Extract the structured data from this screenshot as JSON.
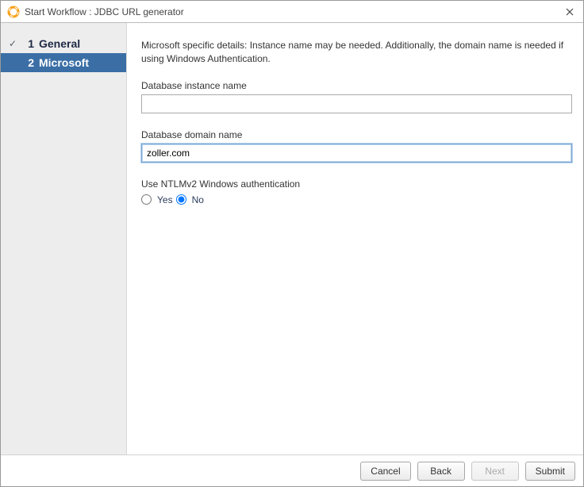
{
  "window": {
    "title": "Start Workflow : JDBC URL generator"
  },
  "sidebar": {
    "steps": [
      {
        "num": "1",
        "label": "General"
      },
      {
        "num": "2",
        "label": "Microsoft"
      }
    ]
  },
  "main": {
    "description": "Microsoft specific details: Instance name may be needed. Additionally, the domain name is needed if using Windows Authentication.",
    "instance": {
      "label": "Database instance name",
      "value": ""
    },
    "domain": {
      "label": "Database domain name",
      "value": "zoller.com"
    },
    "ntlm": {
      "label": "Use NTLMv2 Windows authentication",
      "yes": "Yes",
      "no": "No",
      "selected": "No"
    }
  },
  "footer": {
    "cancel": "Cancel",
    "back": "Back",
    "next": "Next",
    "submit": "Submit"
  }
}
